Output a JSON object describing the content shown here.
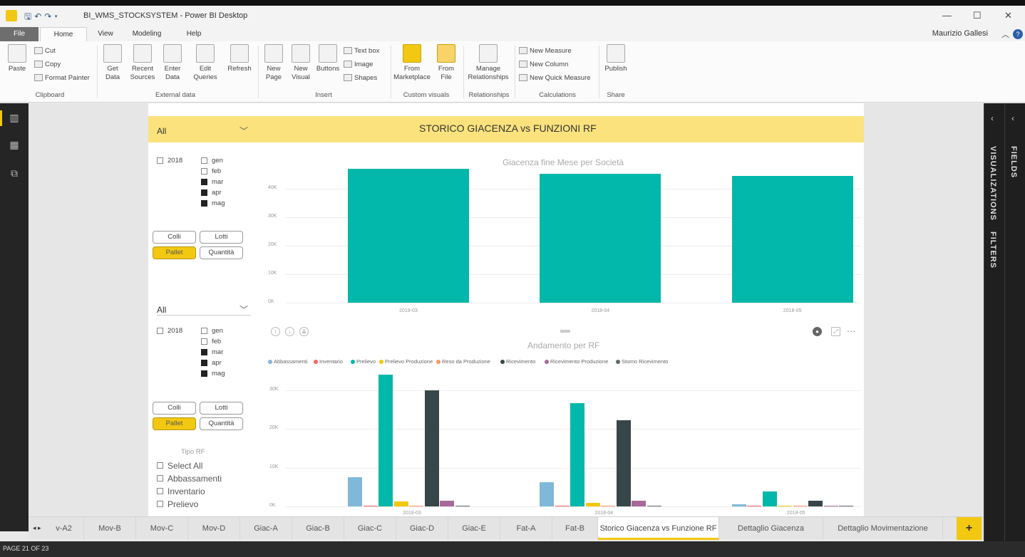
{
  "window": {
    "title": "BI_WMS_STOCKSYSTEM - Power BI Desktop",
    "controls": [
      "—",
      "☐",
      "✕"
    ]
  },
  "menu": {
    "file": "File",
    "tabs": [
      "Home",
      "View",
      "Modeling",
      "Help"
    ],
    "user": "Maurizio Gallesi"
  },
  "ribbon": {
    "paste": "Paste",
    "cut": "Cut",
    "copy": "Copy",
    "format_painter": "Format Painter",
    "get_data": "Get Data",
    "recent_sources": "Recent Sources",
    "enter_data": "Enter Data",
    "edit_queries": "Edit Queries",
    "refresh": "Refresh",
    "new_page": "New Page",
    "new_visual": "New Visual",
    "buttons": "Buttons",
    "text_box": "Text box",
    "image": "Image",
    "shapes": "Shapes",
    "from_marketplace": "From Marketplace",
    "from_file": "From File",
    "manage_relationships": "Manage Relationships",
    "new_measure": "New Measure",
    "new_column": "New Column",
    "new_quick_measure": "New Quick Measure",
    "publish": "Publish",
    "groups": {
      "clipboard": "Clipboard",
      "external_data": "External data",
      "insert": "Insert",
      "custom_visuals": "Custom visuals",
      "relationships": "Relationships",
      "calculations": "Calculations",
      "share": "Share"
    }
  },
  "report": {
    "banner_title": "STORICO GIACENZA vs FUNZIONI RF",
    "slicer1": {
      "value": "All",
      "year": "2018",
      "months": [
        "gen",
        "feb",
        "mar",
        "apr",
        "mag"
      ],
      "checked": [
        false,
        false,
        true,
        true,
        true
      ]
    },
    "slicer2": {
      "value": "All",
      "year": "2018",
      "months": [
        "gen",
        "feb",
        "mar",
        "apr",
        "mag"
      ],
      "checked": [
        false,
        false,
        true,
        true,
        true
      ]
    },
    "measure_buttons": [
      "Colli",
      "Lotti",
      "Pallet",
      "Quantità"
    ],
    "tipo_rf": {
      "title": "Tipo RF",
      "items": [
        "Select All",
        "Abbassamenti",
        "Inventario",
        "Prelievo"
      ]
    }
  },
  "chart_data": [
    {
      "type": "bar",
      "title": "Giacenza fine Mese per Società",
      "categories": [
        "2018-03",
        "2018-04",
        "2018-05"
      ],
      "values": [
        47000,
        45200,
        44500
      ],
      "ylim": [
        0,
        50000
      ],
      "yticks": [
        "0K",
        "10K",
        "20K",
        "30K",
        "40K"
      ],
      "color": "#01b8aa",
      "grid": true
    },
    {
      "type": "bar",
      "title": "Andamento per RF",
      "categories": [
        "2018-03",
        "2018-04",
        "2018-05"
      ],
      "ylim": [
        0,
        35000
      ],
      "yticks": [
        "0K",
        "10K",
        "20K",
        "30K"
      ],
      "legend_position": "top-left",
      "series": [
        {
          "name": "Abbassamenti",
          "color": "#7fb8d9",
          "values": [
            7500,
            6200,
            600
          ]
        },
        {
          "name": "Inventario",
          "color": "#fd625e",
          "values": [
            100,
            100,
            50
          ]
        },
        {
          "name": "Prelievo",
          "color": "#01b8aa",
          "values": [
            34000,
            26800,
            3800
          ]
        },
        {
          "name": "Prelievo Produzione",
          "color": "#f2c80f",
          "values": [
            1200,
            1000,
            100
          ]
        },
        {
          "name": "Reso da Produzione",
          "color": "#fe9666",
          "values": [
            100,
            100,
            50
          ]
        },
        {
          "name": "Ricevimento",
          "color": "#374649",
          "values": [
            30000,
            22200,
            1500
          ]
        },
        {
          "name": "Ricevimento Produzione",
          "color": "#a66999",
          "values": [
            1500,
            1400,
            200
          ]
        },
        {
          "name": "Storno Ricevimento",
          "color": "#5f6b6d",
          "values": [
            200,
            200,
            100
          ]
        }
      ],
      "grid": true
    }
  ],
  "right_panes": [
    "VISUALIZATIONS",
    "FILTERS",
    "FIELDS"
  ],
  "page_tabs": [
    "v-A2",
    "Mov-B",
    "Mov-C",
    "Mov-D",
    "Giac-A",
    "Giac-B",
    "Giac-C",
    "Giac-D",
    "Giac-E",
    "Fat-A",
    "Fat-B",
    "Storico Giacenza vs Funzione RF",
    "Dettaglio Giacenza",
    "Dettaglio Movimentazione"
  ],
  "active_tab_index": 11,
  "add_tab": "+",
  "status": "PAGE 21 OF 23"
}
